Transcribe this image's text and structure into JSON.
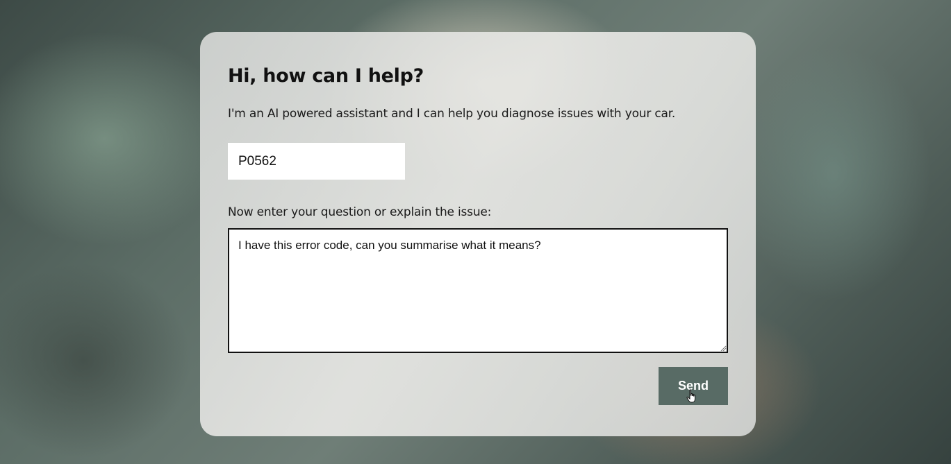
{
  "form": {
    "title": "Hi, how can I help?",
    "intro": "I'm an AI powered assistant and I can help you diagnose issues with your car.",
    "error_code_value": "P0562",
    "question_label": "Now enter your question or explain the issue:",
    "question_value": "I have this error code, can you summarise what it means?",
    "send_label": "Send"
  },
  "icons": {
    "cursor": "hand-pointer-icon",
    "resize": "resize-grip-icon"
  },
  "colors": {
    "send_button": "#586b65"
  }
}
